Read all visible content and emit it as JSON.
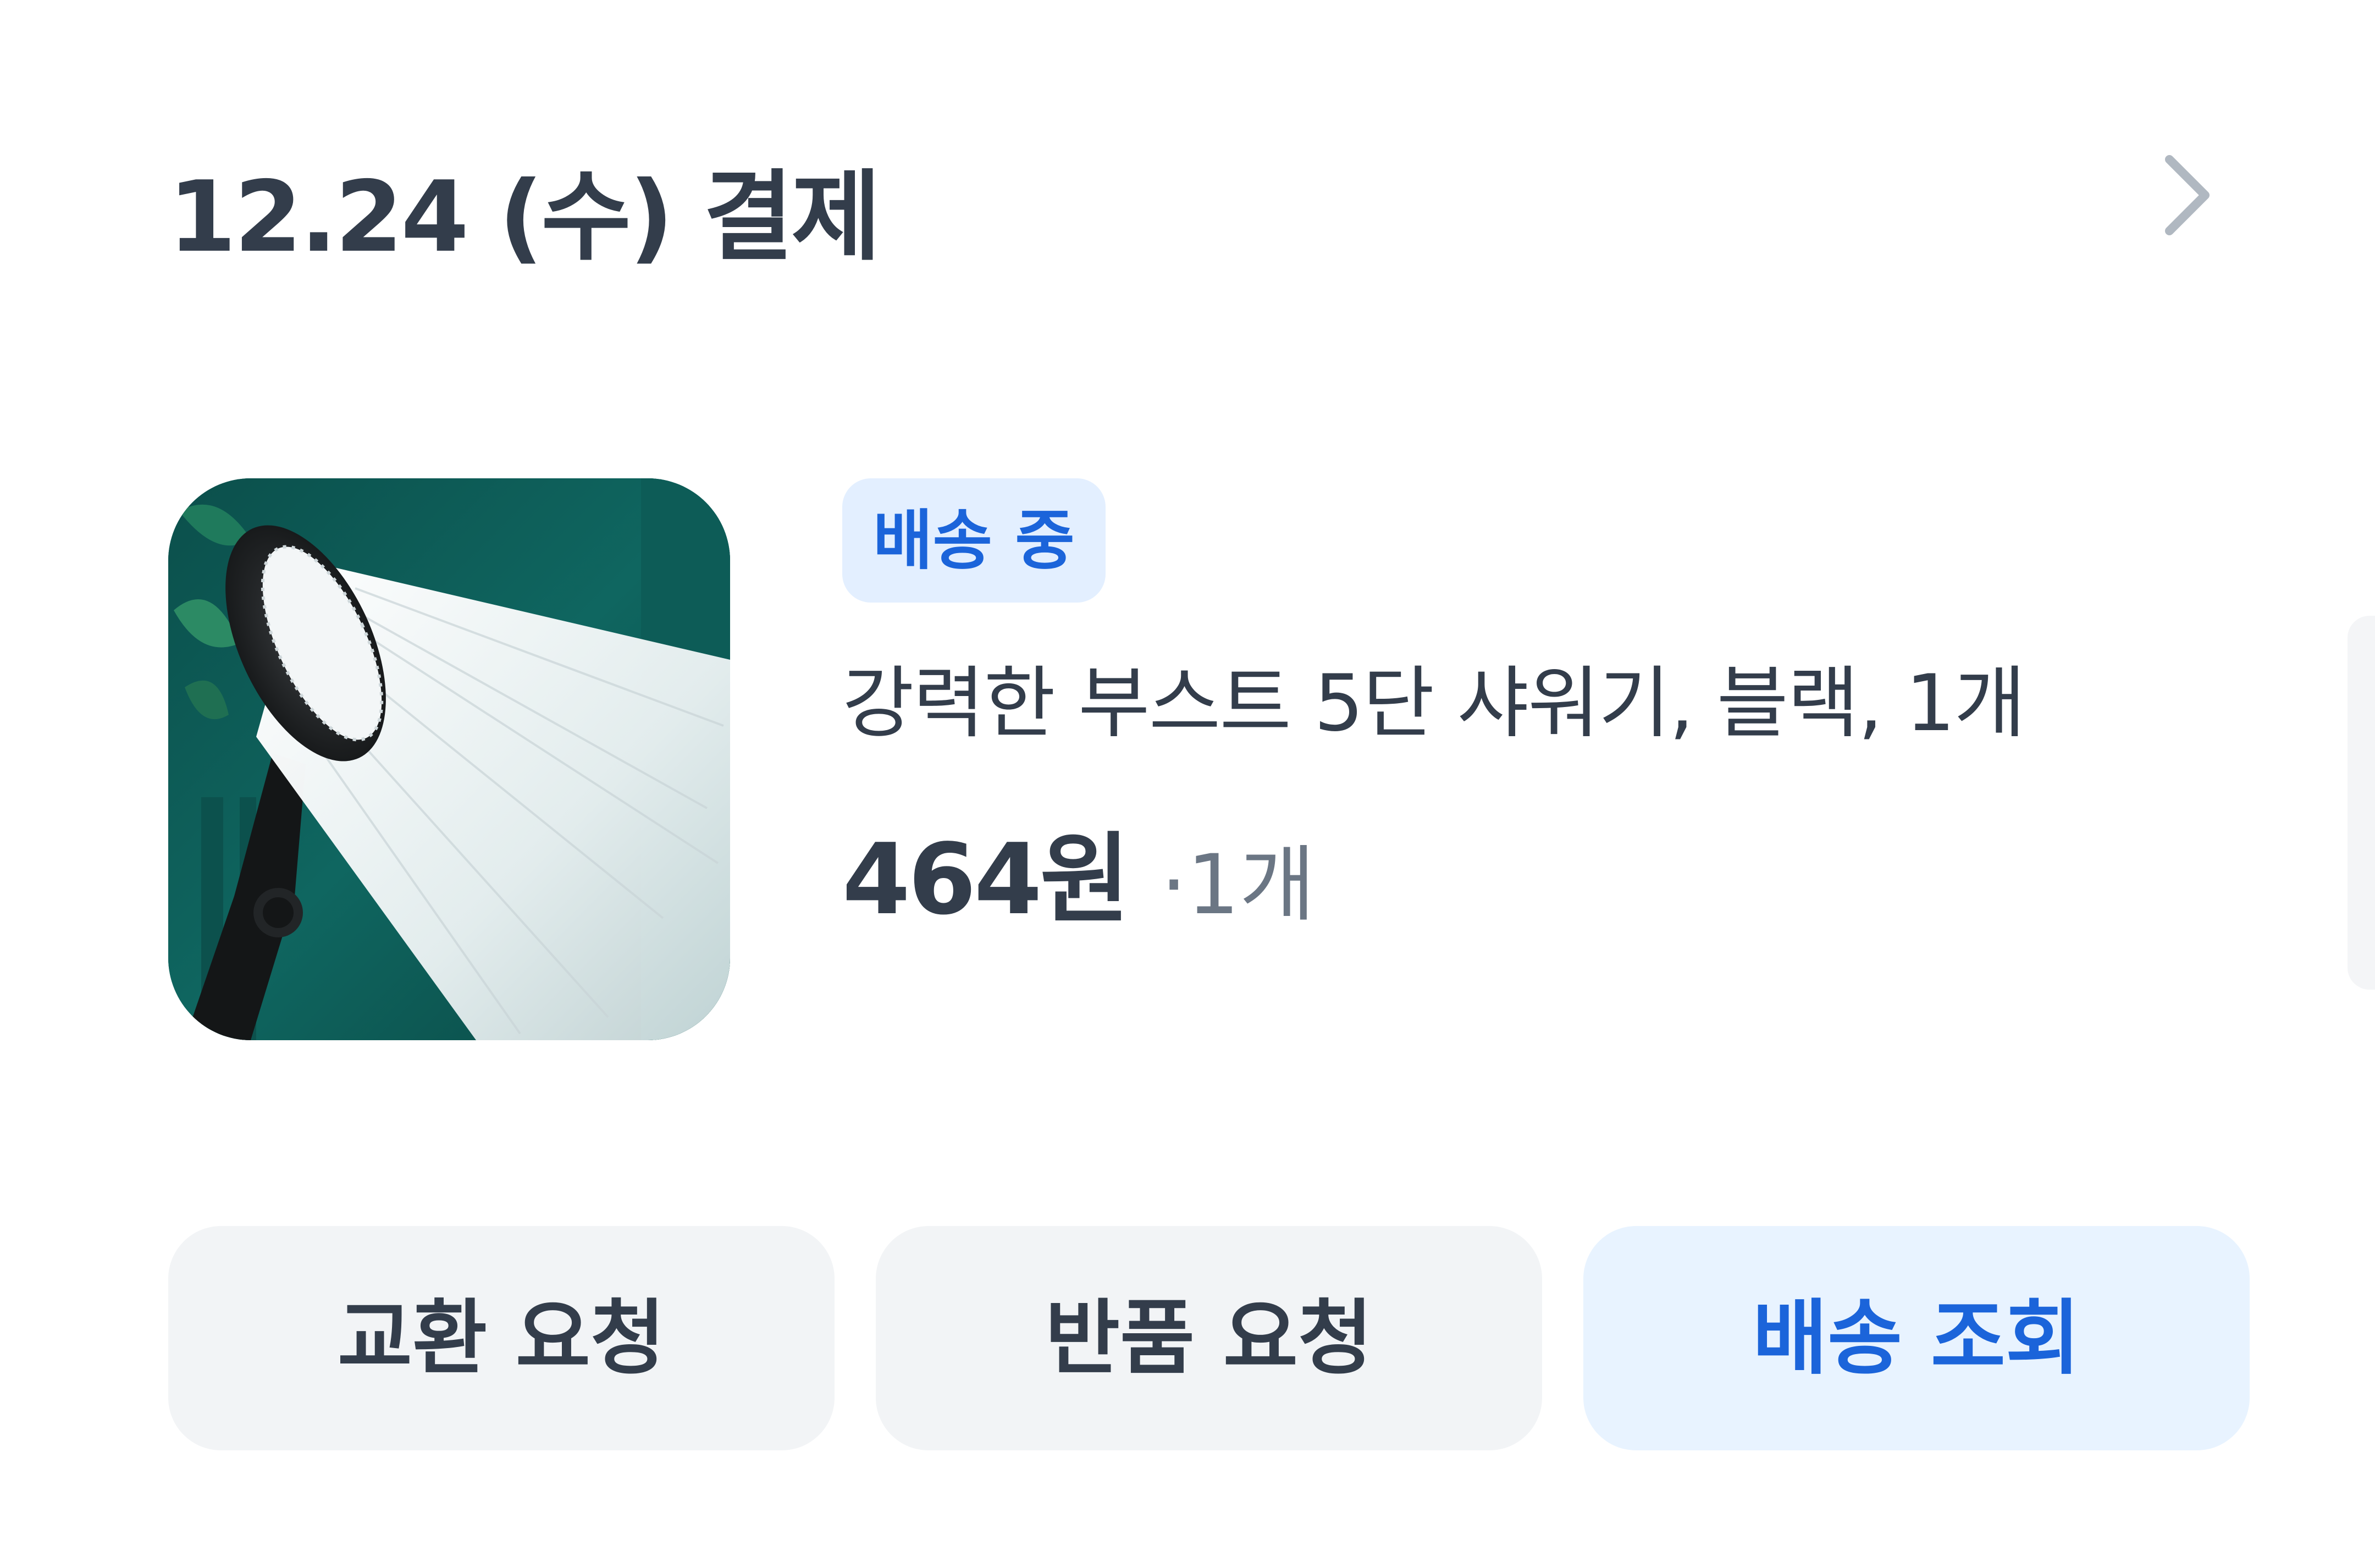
{
  "order": {
    "date_label": "12.24 (수) 결제",
    "detail_icon": "chevron-right-icon"
  },
  "product": {
    "image_description_icon": "shower-head-image",
    "status": "배송 중",
    "name": "강력한 부스트 5단 샤워기, 블랙, 1개",
    "price": "464원",
    "quantity": "·1개"
  },
  "actions": {
    "exchange_label": "교환 요청",
    "return_label": "반품 요청",
    "track_label": "배송 조회"
  },
  "colors": {
    "text_primary": "#333d4b",
    "text_secondary": "#6b7684",
    "accent_blue": "#1b64da",
    "badge_bg": "#e3efff",
    "button_bg": "#f2f4f6",
    "primary_button_bg": "#e8f3ff"
  }
}
